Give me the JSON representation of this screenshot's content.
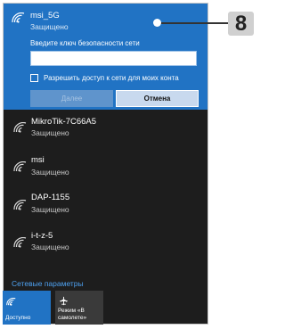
{
  "colors": {
    "accent": "#2173c4",
    "panel_bg": "#1d1d1d",
    "link": "#4ea1f0",
    "badge_bg": "#d0d0d0"
  },
  "icons": {
    "network": "wifi-icon",
    "airplane": "airplane-icon"
  },
  "selected_network": {
    "name": "msi_5G",
    "status": "Защищено",
    "prompt": "Введите ключ безопасности сети",
    "key_value": "",
    "share_checked": false,
    "share_label": "Разрешить доступ к сети для моих конта",
    "next_label": "Далее",
    "cancel_label": "Отмена"
  },
  "networks": [
    {
      "name": "MikroTik-7C66A5",
      "status": "Защищено"
    },
    {
      "name": "msi",
      "status": "Защищено"
    },
    {
      "name": "DAP-1155",
      "status": "Защищено"
    },
    {
      "name": "i-t-z-5",
      "status": "Защищено"
    }
  ],
  "settings_link": "Сетевые параметры",
  "tiles": {
    "wifi": {
      "label": "Доступно",
      "active": true
    },
    "airplane": {
      "line1": "Режим «В",
      "line2": "самолете»",
      "active": false
    }
  },
  "callout": {
    "number": "8"
  }
}
